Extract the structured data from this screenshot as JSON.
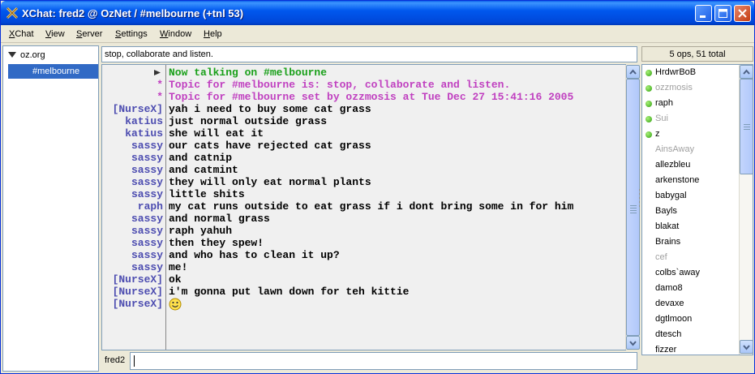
{
  "window": {
    "title": "XChat: fred2 @ OzNet / #melbourne (+tnl 53)"
  },
  "menu": [
    "XChat",
    "View",
    "Server",
    "Settings",
    "Window",
    "Help"
  ],
  "tree": {
    "network": "oz.org",
    "channel": "#melbourne"
  },
  "topic_bar": "stop, collaborate and listen.",
  "user_count": "5 ops, 51 total",
  "chat": {
    "lines": [
      {
        "nick": "",
        "text": "Now talking on #melbourne",
        "kind": "join"
      },
      {
        "nick": "*",
        "text": "Topic for #melbourne is: stop, collaborate and listen.",
        "kind": "topic"
      },
      {
        "nick": "*",
        "text": "Topic for #melbourne set by ozzmosis at Tue Dec 27 15:41:16 2005",
        "kind": "topic"
      },
      {
        "nick": "[NurseX]",
        "text": "yah i need to buy some cat grass",
        "kind": "msg"
      },
      {
        "nick": "katius",
        "text": "just normal outside grass",
        "kind": "msg"
      },
      {
        "nick": "katius",
        "text": "she will eat it",
        "kind": "msg"
      },
      {
        "nick": "sassy",
        "text": "our cats have rejected cat grass",
        "kind": "msg"
      },
      {
        "nick": "sassy",
        "text": "and catnip",
        "kind": "msg"
      },
      {
        "nick": "sassy",
        "text": "and catmint",
        "kind": "msg"
      },
      {
        "nick": "sassy",
        "text": "they will only eat normal plants",
        "kind": "msg"
      },
      {
        "nick": "sassy",
        "text": "little shits",
        "kind": "msg"
      },
      {
        "nick": "raph",
        "text": "my cat runs outside to eat grass if i dont bring some in for him",
        "kind": "msg"
      },
      {
        "nick": "sassy",
        "text": "and normal grass",
        "kind": "msg"
      },
      {
        "nick": "sassy",
        "text": "raph yahuh",
        "kind": "msg"
      },
      {
        "nick": "sassy",
        "text": "then they spew!",
        "kind": "msg"
      },
      {
        "nick": "sassy",
        "text": "and who has to clean it up?",
        "kind": "msg"
      },
      {
        "nick": "sassy",
        "text": "me!",
        "kind": "msg"
      },
      {
        "nick": "[NurseX]",
        "text": "ok",
        "kind": "msg"
      },
      {
        "nick": "[NurseX]",
        "text": "i'm gonna put lawn down for teh kittie",
        "kind": "msg"
      },
      {
        "nick": "[NurseX]",
        "text": "",
        "kind": "smiley"
      }
    ]
  },
  "input": {
    "nick_label": "fred2",
    "value": ""
  },
  "users": [
    {
      "name": "HrdwrBoB",
      "op": true,
      "away": false
    },
    {
      "name": "ozzmosis",
      "op": true,
      "away": true
    },
    {
      "name": "raph",
      "op": true,
      "away": false
    },
    {
      "name": "Sui",
      "op": true,
      "away": true
    },
    {
      "name": "z",
      "op": true,
      "away": false
    },
    {
      "name": "AinsAway",
      "op": false,
      "away": true
    },
    {
      "name": "allezbleu",
      "op": false,
      "away": false
    },
    {
      "name": "arkenstone",
      "op": false,
      "away": false
    },
    {
      "name": "babygal",
      "op": false,
      "away": false
    },
    {
      "name": "Bayls",
      "op": false,
      "away": false
    },
    {
      "name": "blakat",
      "op": false,
      "away": false
    },
    {
      "name": "Brains",
      "op": false,
      "away": false
    },
    {
      "name": "cef",
      "op": false,
      "away": true
    },
    {
      "name": "colbs`away",
      "op": false,
      "away": false
    },
    {
      "name": "damo8",
      "op": false,
      "away": false
    },
    {
      "name": "devaxe",
      "op": false,
      "away": false
    },
    {
      "name": "dgtlmoon",
      "op": false,
      "away": false
    },
    {
      "name": "dtesch",
      "op": false,
      "away": false
    },
    {
      "name": "fizzer",
      "op": false,
      "away": false
    }
  ]
}
